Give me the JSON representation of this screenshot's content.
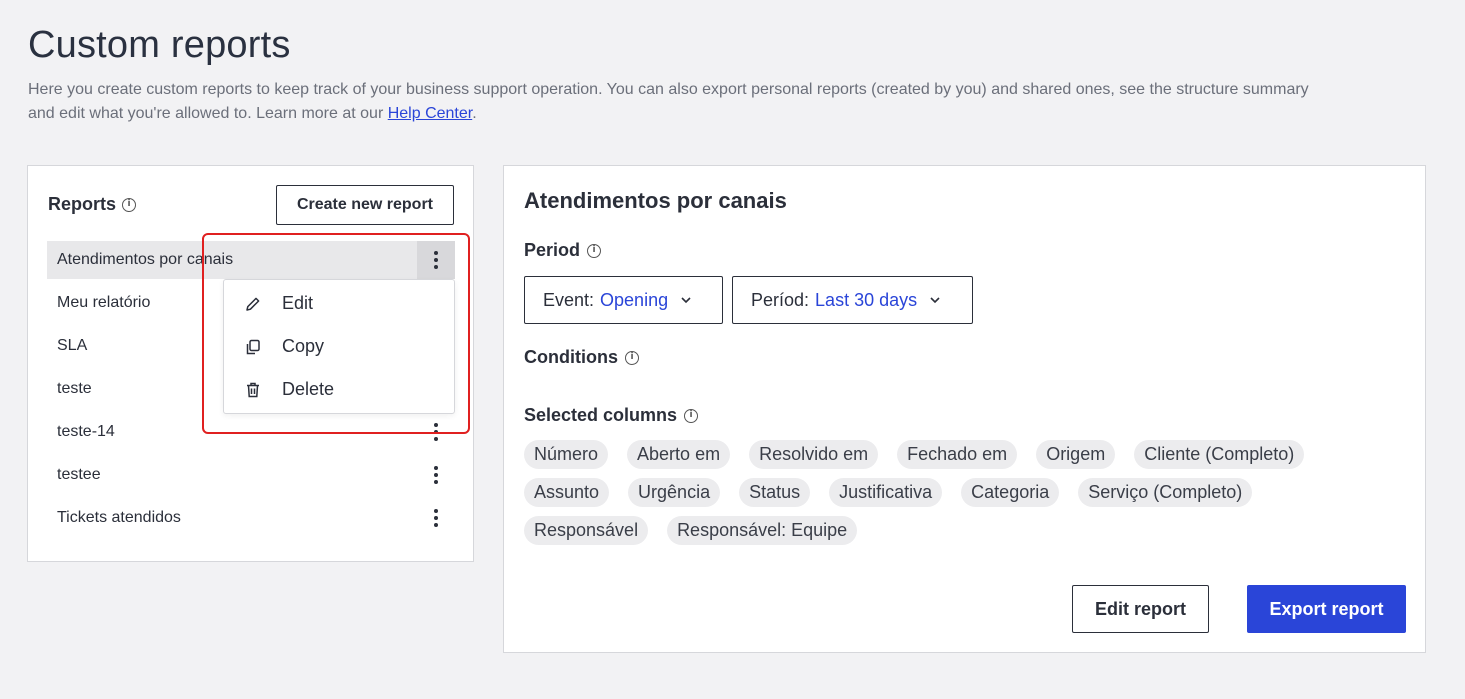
{
  "header": {
    "title": "Custom reports",
    "description_before_link": "Here you create custom reports to keep track of your business support operation. You can also export personal reports (created by you) and shared ones, see the structure summary and edit what you're allowed to. Learn more at our ",
    "help_link": "Help Center",
    "description_after_link": "."
  },
  "reports": {
    "heading": "Reports",
    "create_button": "Create new report",
    "items": [
      {
        "label": "Atendimentos por canais"
      },
      {
        "label": "Meu relatório"
      },
      {
        "label": "SLA"
      },
      {
        "label": "teste"
      },
      {
        "label": "teste-14"
      },
      {
        "label": "testee"
      },
      {
        "label": "Tickets atendidos"
      }
    ]
  },
  "context_menu": {
    "edit": "Edit",
    "copy": "Copy",
    "delete": "Delete"
  },
  "detail": {
    "title": "Atendimentos por canais",
    "period_label": "Period",
    "event_prefix": "Event:",
    "event_value": "Opening",
    "period_prefix": "Períod:",
    "period_value": "Last 30 days",
    "conditions_label": "Conditions",
    "columns_label": "Selected columns",
    "columns_row1": [
      "Número",
      "Aberto em",
      "Resolvido em",
      "Fechado em",
      "Origem",
      "Cliente (Completo)"
    ],
    "columns_row2": [
      "Assunto",
      "Urgência",
      "Status",
      "Justificativa",
      "Categoria",
      "Serviço (Completo)"
    ],
    "columns_row3": [
      "Responsável",
      "Responsável: Equipe"
    ],
    "edit_button": "Edit report",
    "export_button": "Export report"
  },
  "colors": {
    "accent": "#2a45d8",
    "highlight": "#e02020",
    "background": "#f2f2f4"
  }
}
